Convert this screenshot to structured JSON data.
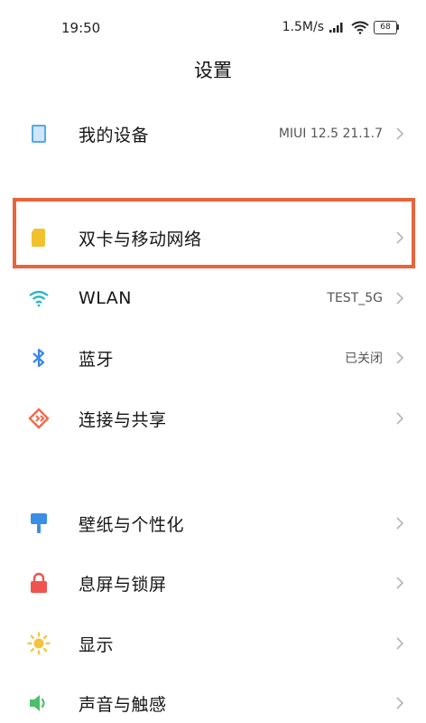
{
  "status_bar": {
    "time": "19:50",
    "network_speed": "1.5M/s",
    "battery_level": "68"
  },
  "header": {
    "title": "设置"
  },
  "rows": [
    {
      "label": "我的设备",
      "value": "MIUI 12.5 21.1.7",
      "icon": "device-icon",
      "icon_color": "#5aa8e8"
    },
    {
      "label": "双卡与移动网络",
      "value": "",
      "icon": "sim-card-icon",
      "icon_color": "#f2c12e"
    },
    {
      "label": "WLAN",
      "value": "TEST_5G",
      "icon": "wifi-icon",
      "icon_color": "#2fb7c7"
    },
    {
      "label": "蓝牙",
      "value": "已关闭",
      "icon": "bluetooth-icon",
      "icon_color": "#3a86e6"
    },
    {
      "label": "连接与共享",
      "value": "",
      "icon": "connection-share-icon",
      "icon_color": "#f26a4b"
    },
    {
      "label": "壁纸与个性化",
      "value": "",
      "icon": "wallpaper-icon",
      "icon_color": "#3a8ee6"
    },
    {
      "label": "息屏与锁屏",
      "value": "",
      "icon": "lock-icon",
      "icon_color": "#ef5350"
    },
    {
      "label": "显示",
      "value": "",
      "icon": "brightness-icon",
      "icon_color": "#f5c33b"
    },
    {
      "label": "声音与触感",
      "value": "",
      "icon": "sound-icon",
      "icon_color": "#4cbf6b"
    }
  ],
  "highlight_color": "#e8643a"
}
